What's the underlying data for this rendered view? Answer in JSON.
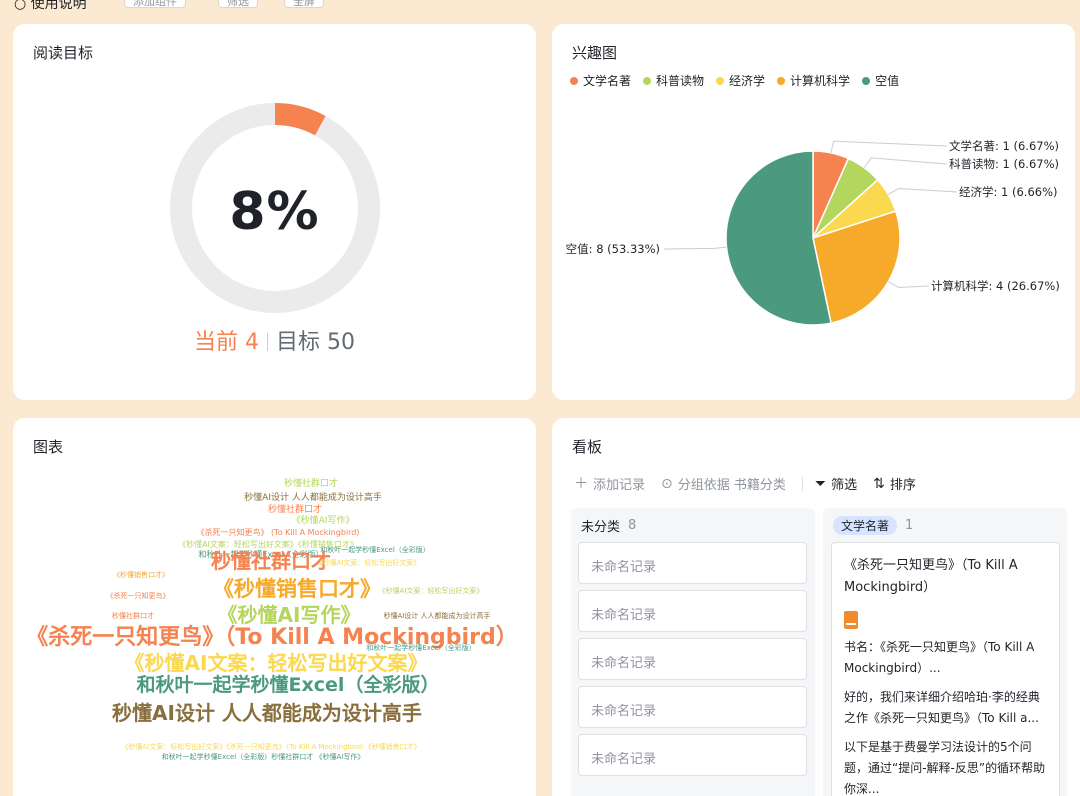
{
  "topbar": {
    "label": "○ 使用说明",
    "buttons": [
      "添加组件",
      "筛选",
      "全屏"
    ]
  },
  "goal": {
    "title": "阅读目标",
    "percent_text": "8%",
    "progress": 0.08,
    "current_label": "当前 4",
    "target_label": "目标 50",
    "accent": "#f5824f"
  },
  "interest": {
    "title": "兴趣图",
    "legend": [
      {
        "name": "文学名著",
        "color": "#f5824f"
      },
      {
        "name": "科普读物",
        "color": "#b5d65e"
      },
      {
        "name": "经济学",
        "color": "#fad84f"
      },
      {
        "name": "计算机科学",
        "color": "#f7a929"
      },
      {
        "name": "空值",
        "color": "#4b9a80"
      }
    ]
  },
  "chart_data": {
    "type": "pie",
    "slices": [
      {
        "name": "文学名著",
        "value": 1,
        "label": "文学名著: 1 (6.67%)",
        "color": "#f5824f"
      },
      {
        "name": "科普读物",
        "value": 1,
        "label": "科普读物: 1 (6.67%)",
        "color": "#b5d65e"
      },
      {
        "name": "经济学",
        "value": 1,
        "label": "经济学: 1 (6.66%)",
        "color": "#fad84f"
      },
      {
        "name": "计算机科学",
        "value": 4,
        "label": "计算机科学: 4 (26.67%)",
        "color": "#f7a929"
      },
      {
        "name": "空值",
        "value": 8,
        "label": "空值: 8 (53.33%)",
        "color": "#4b9a80"
      }
    ],
    "legend_position": "top-left"
  },
  "cloud": {
    "title": "图表",
    "words": [
      {
        "text": "秒懂社群口才",
        "size": 9,
        "color": "#b5d65e"
      },
      {
        "text": "秒懂AI设计 人人都能成为设计高手",
        "size": 9,
        "color": "#8a6f3e"
      },
      {
        "text": "秒懂社群口才",
        "size": 9,
        "color": "#f5824f"
      },
      {
        "text": "《秒懂AI写作》",
        "size": 9,
        "color": "#b5d65e"
      },
      {
        "text": "《杀死一只知更鸟》 (To Kill A Mockingbird)",
        "size": 8,
        "color": "#f5824f"
      },
      {
        "text": "《秒懂AI文案：轻松写出好文案》《秒懂销售口才》",
        "size": 8,
        "color": "#b5d65e"
      },
      {
        "text": "和秋叶一起学秒懂Excel（全彩版）",
        "size": 8,
        "color": "#4b9a80"
      },
      {
        "text": "和秋叶一起学秒懂Excel（全彩版）",
        "size": 7,
        "color": "#4b9a80"
      },
      {
        "text": "秒懂社群口才",
        "size": 20,
        "color": "#f5824f"
      },
      {
        "text": "《秒懂AI文案：轻松写出好文案》",
        "size": 7,
        "color": "#fad84f"
      },
      {
        "text": "《秒懂销售口才》",
        "size": 21,
        "color": "#f7a929"
      },
      {
        "text": "《秒懂AI写作》",
        "size": 20,
        "color": "#b5d65e"
      },
      {
        "text": "《杀死一只知更鸟》（To Kill A Mockingbird）",
        "size": 22,
        "color": "#f5824f"
      },
      {
        "text": "《秒懂AI文案：轻松写出好文案》",
        "size": 20,
        "color": "#fad84f"
      },
      {
        "text": "和秋叶一起学秒懂Excel（全彩版）",
        "size": 19,
        "color": "#4b9a80"
      },
      {
        "text": "秒懂AI设计 人人都能成为设计高手",
        "size": 20,
        "color": "#8a6f3e"
      },
      {
        "text": "《秒懂销售口才》",
        "size": 7,
        "color": "#f7a929"
      },
      {
        "text": "《杀死一只知更鸟》",
        "size": 7,
        "color": "#f5824f"
      },
      {
        "text": "秒懂社群口才",
        "size": 7,
        "color": "#f5824f"
      },
      {
        "text": "《秒懂AI文案：轻松写出好文案》",
        "size": 7,
        "color": "#b5d65e"
      },
      {
        "text": "秒懂AI设计 人人都能成为设计高手",
        "size": 7,
        "color": "#8a6f3e"
      },
      {
        "text": "和秋叶一起学秒懂Excel（全彩版）",
        "size": 7,
        "color": "#4b9a80"
      },
      {
        "text": "《秒懂AI文案：轻松写出好文案》《杀死一只知更鸟》（To Kill A Mockingbird）《秒懂销售口才》",
        "size": 7,
        "color": "#fad84f"
      },
      {
        "text": "和秋叶一起学秒懂Excel（全彩版）秒懂社群口才 《秒懂AI写作》",
        "size": 7,
        "color": "#4b9a80"
      }
    ]
  },
  "kanban": {
    "title": "看板",
    "toolbar": {
      "add": "添加记录",
      "group": "分组依据 书籍分类",
      "filter": "筛选",
      "sort": "排序"
    },
    "columns": [
      {
        "name": "未分类",
        "count": "8",
        "records": [
          "未命名记录",
          "未命名记录",
          "未命名记录",
          "未命名记录",
          "未命名记录"
        ]
      },
      {
        "name": "文学名著",
        "count": "1"
      }
    ],
    "book": {
      "title": "《杀死一只知更鸟》（To Kill A Mockingbird）",
      "name_line": "书名：《杀死一只知更鸟》（To Kill A Mockingbird）...",
      "desc1": "好的，我们来详细介绍哈珀·李的经典之作《杀死一只知更鸟》（To Kill a...",
      "desc2": "以下是基于费曼学习法设计的5个问题，通过“提问-解释-反思”的循环帮助你深..."
    }
  }
}
